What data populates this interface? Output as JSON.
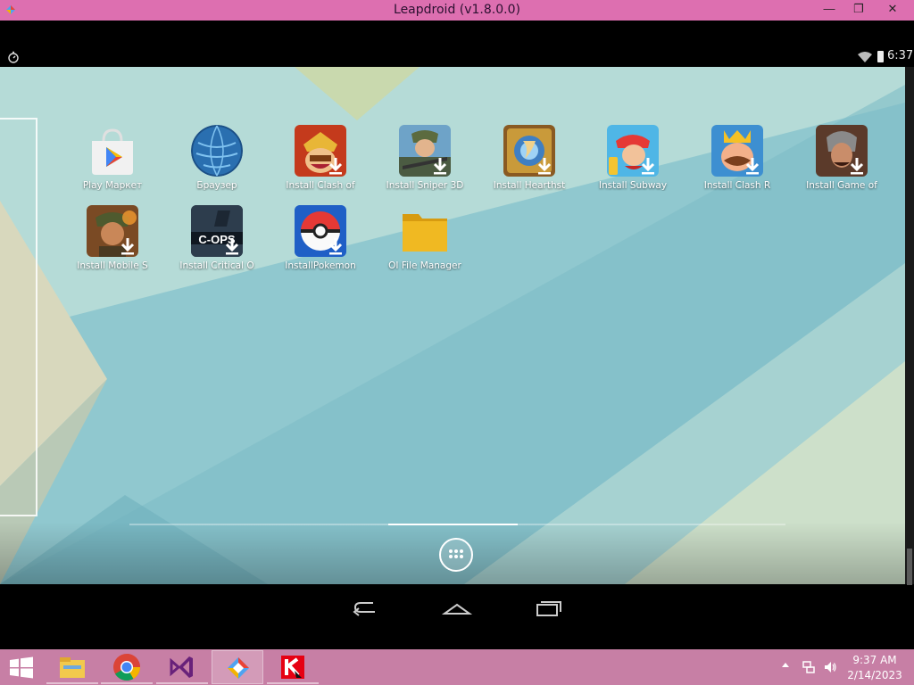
{
  "window": {
    "title": "Leapdroid (v1.8.0.0)"
  },
  "status": {
    "time": "6:37"
  },
  "apps": [
    {
      "label": "Play Маркет"
    },
    {
      "label": "Браузер"
    },
    {
      "label": "Install Clash of"
    },
    {
      "label": "Install Sniper 3D"
    },
    {
      "label": "Install Hearthst"
    },
    {
      "label": "Install Subway"
    },
    {
      "label": "Install Clash R"
    },
    {
      "label": "Install Game of"
    },
    {
      "label": "Install Mobile S"
    },
    {
      "label": "Install Critical O"
    },
    {
      "label": "InstallPokemon"
    },
    {
      "label": "OI File Manager"
    }
  ],
  "critical_ops_text": "C-OPS",
  "tray": {
    "time": "9:37 AM",
    "date": "2/14/2023"
  },
  "colors": {
    "titlebar": "#dd6fb0",
    "taskbar": "#c77fa5",
    "wallpaper": "#8fc7cd"
  }
}
